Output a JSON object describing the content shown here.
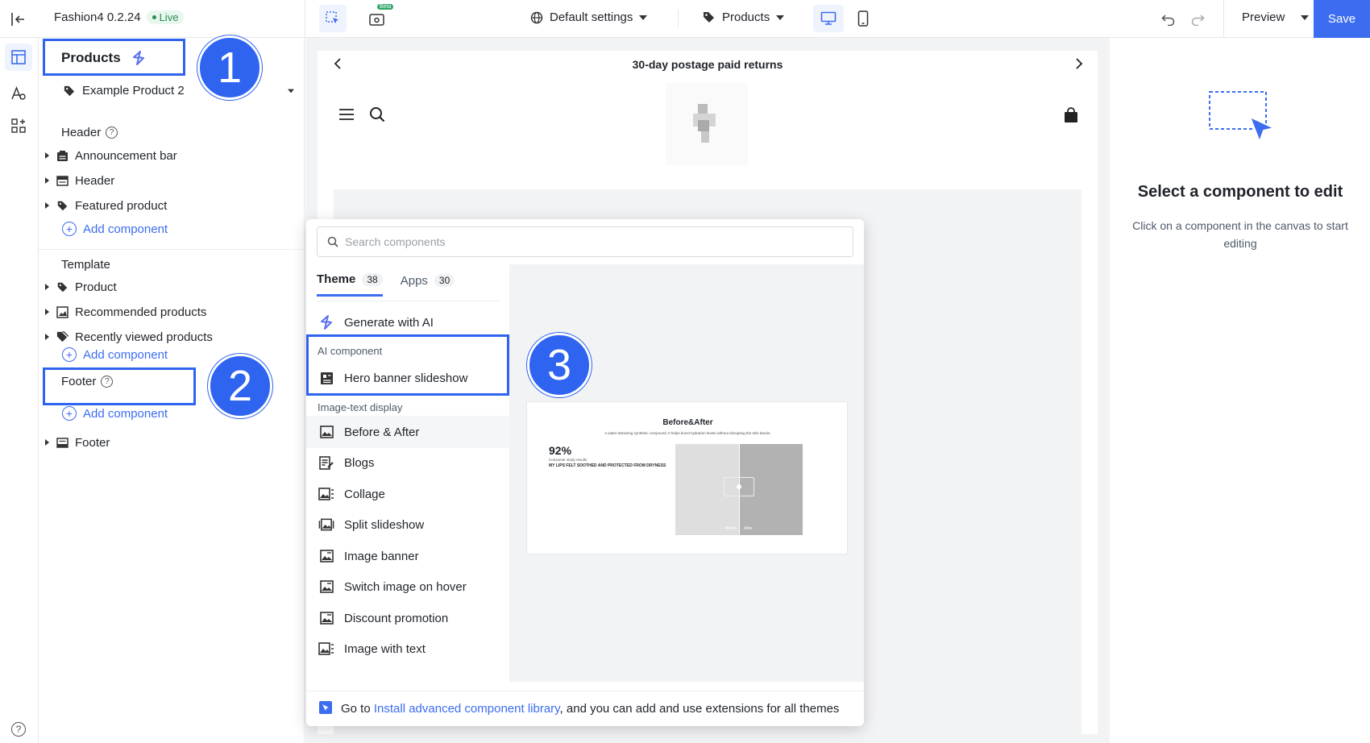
{
  "app": {
    "name": "Fashion4 0.2.24",
    "status": "Live"
  },
  "topbar": {
    "beta_label": "Beta",
    "settings_label": "Default settings",
    "page_label": "Products",
    "preview_label": "Preview",
    "save_label": "Save"
  },
  "panel": {
    "title": "Products",
    "product_selector": "Example Product 2",
    "header_section": "Header",
    "header_items": [
      "Announcement bar",
      "Header",
      "Featured product"
    ],
    "add_component": "Add component",
    "template_section": "Template",
    "template_items": [
      "Product",
      "Recommended products",
      "Recently viewed products"
    ],
    "footer_section": "Footer",
    "footer_items": [
      "Footer"
    ],
    "help_mark": "?"
  },
  "callouts": [
    "1",
    "2",
    "3"
  ],
  "preview": {
    "announcement": "30-day postage paid returns"
  },
  "popup": {
    "search_placeholder": "Search components",
    "tabs": [
      {
        "label": "Theme",
        "count": "38"
      },
      {
        "label": "Apps",
        "count": "30"
      }
    ],
    "generate_ai": "Generate with AI",
    "group_ai": "AI component",
    "hero": "Hero banner slideshow",
    "group_image_text": "Image-text display",
    "items": [
      "Before & After",
      "Blogs",
      "Collage",
      "Split slideshow",
      "Image banner",
      "Switch image on hover",
      "Discount promotion",
      "Image with text"
    ],
    "thumb": {
      "title": "Before&After",
      "subtitle": "A water-attracting synthetic compound. It helps boost hydration levels without disrupting the skin barrier.",
      "stat": "92%",
      "stat_caption": "Consumer study results",
      "stat_text": "MY LIPS FELT SOOTHED AND PROTECTED FROM DRYNESS",
      "before": "Before",
      "after": "After"
    },
    "footer_prefix": "Go to ",
    "footer_link": "Install advanced component library",
    "footer_suffix": ", and you can add and use extensions for all themes"
  },
  "right_panel": {
    "title": "Select a component to edit",
    "description": "Click on a component in the canvas to start editing"
  },
  "colors": {
    "accent": "#3c6df0",
    "callout": "#2f64f0",
    "live_bg": "#e8f7ee",
    "live_text": "#2a8b4f"
  }
}
